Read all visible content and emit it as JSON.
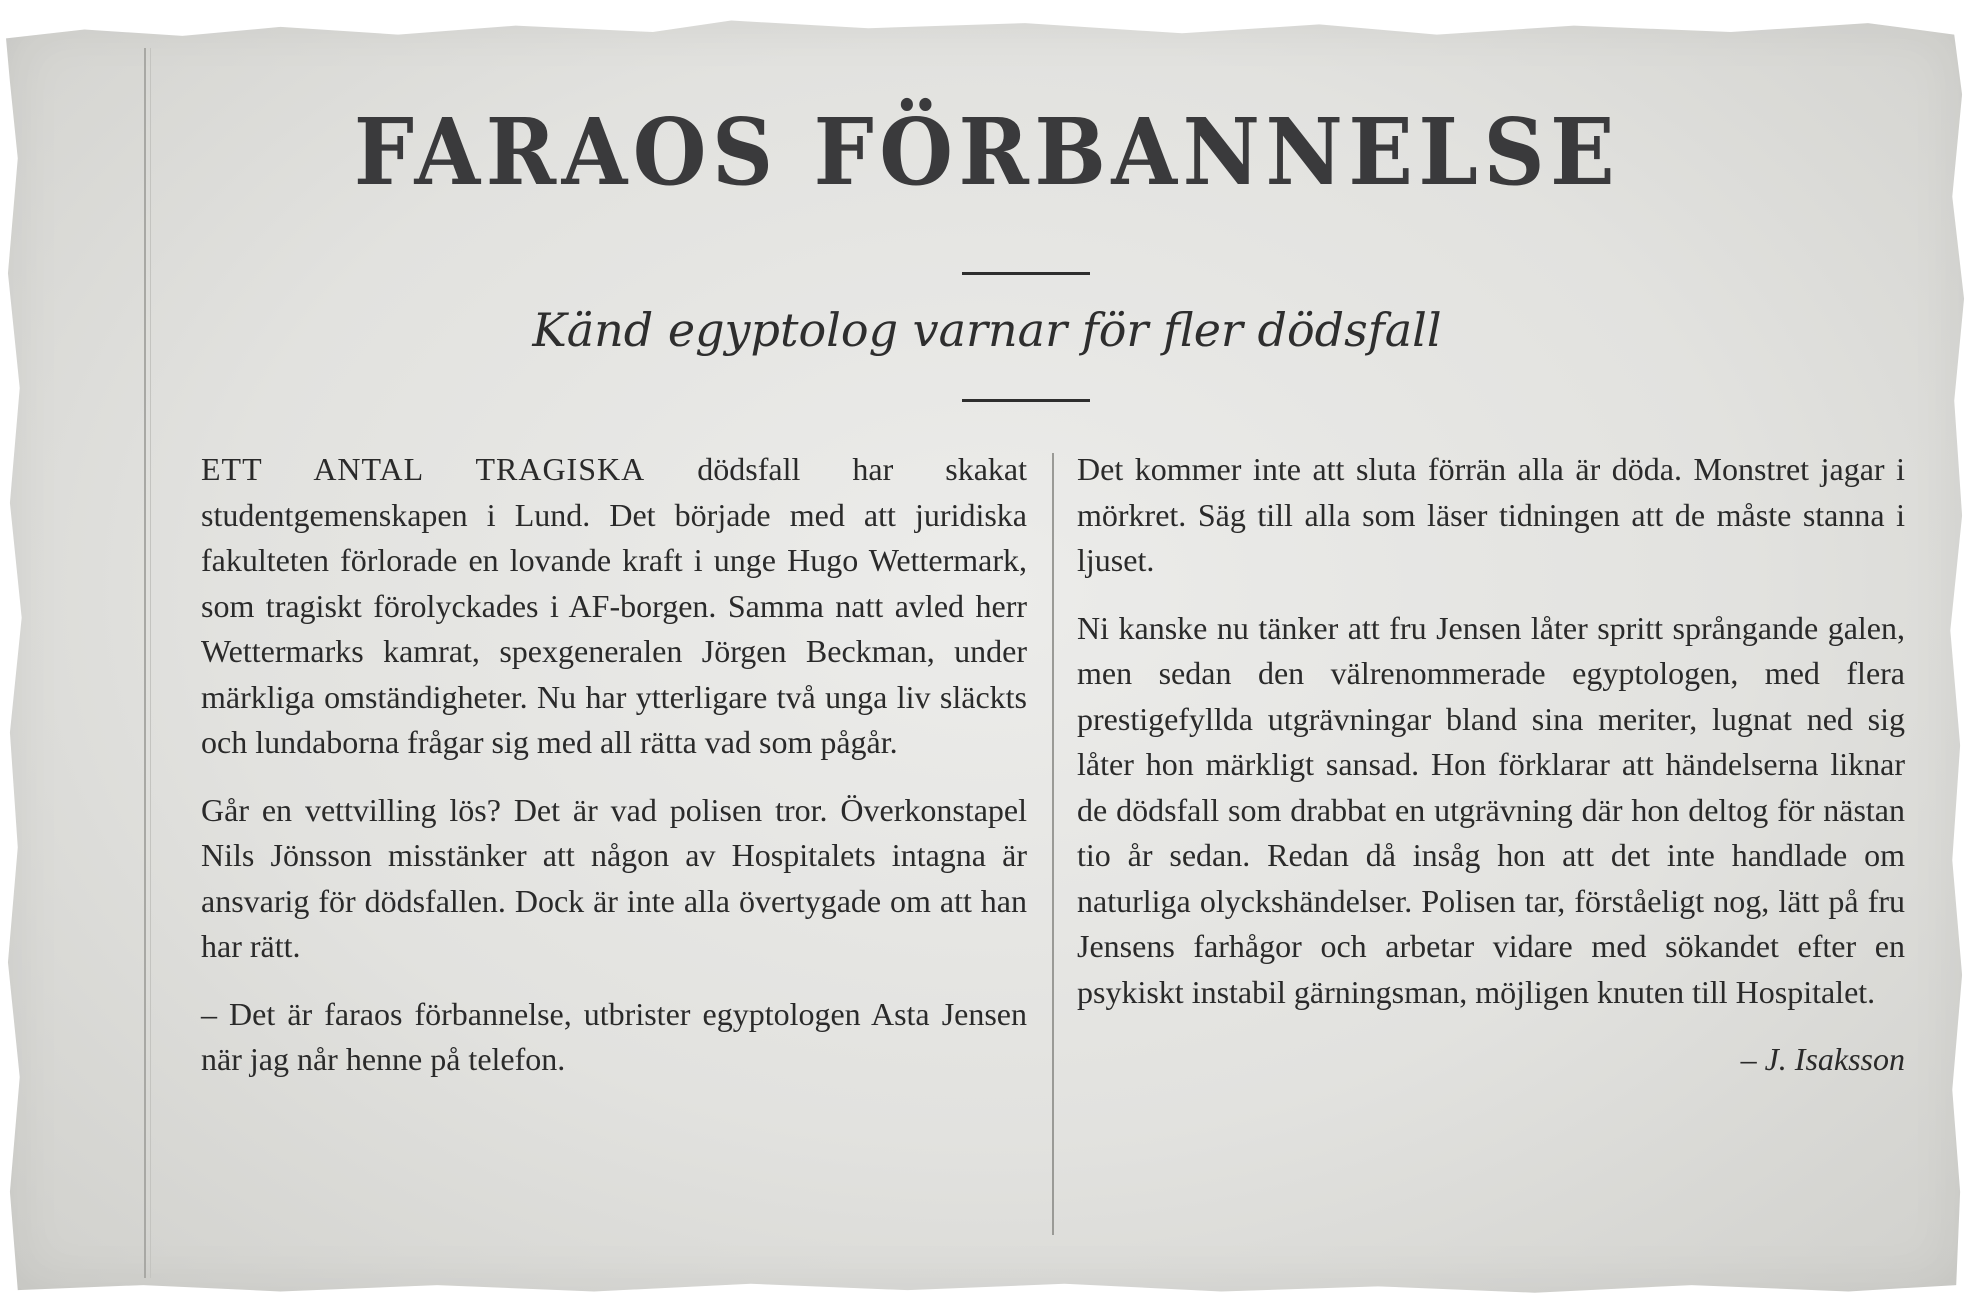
{
  "article": {
    "headline": "FARAOS FÖRBANNELSE",
    "subheadline": "Känd egyptolog varnar för fler dödsfall",
    "left_column": {
      "lead": "ETT ANTAL TRAGISKA",
      "p1_rest": " dödsfall har skakat studentgemenskapen i Lund. Det började med att juridiska fakulteten förlorade en lovande kraft i unge Hugo Wettermark, som tragiskt förolyckades i AF-borgen. Samma natt avled herr Wettermarks kamrat, spexgeneralen Jörgen Beckman, under märkliga omständigheter. Nu har ytterligare två unga liv släckts och lundaborna frågar sig med all rätta vad som pågår.",
      "p2": "Går en vettvilling lös? Det är vad polisen tror. Överkonstapel Nils Jönsson misstänker att någon av Hospitalets intagna är ansvarig för dödsfallen. Dock är inte alla övertygade om att han har rätt.",
      "p3": "– Det är faraos förbannelse, utbrister egyptologen Asta Jensen när jag når henne på telefon."
    },
    "right_column": {
      "p1": "Det kommer inte att sluta förrän alla är döda. Monstret jagar i mörkret. Säg till alla som läser tidningen att de måste stanna i ljuset.",
      "p2": "Ni kanske nu tänker att fru Jensen låter spritt språngande galen, men sedan den välrenommerade egyptologen, med flera prestigefyllda utgrävningar bland sina meriter, lugnat ned sig låter hon märkligt sansad. Hon förklarar att händelserna liknar de dödsfall som drabbat en utgrävning där hon deltog för nästan tio år sedan. Redan då insåg hon att det inte handlade om naturliga olyckshändelser. Polisen tar, förståeligt nog, lätt på fru Jensens farhågor och arbetar vidare med sökandet efter en psykiskt instabil gärningsman, möjligen knuten till Hospitalet.",
      "byline": "– J. Isaksson"
    }
  }
}
